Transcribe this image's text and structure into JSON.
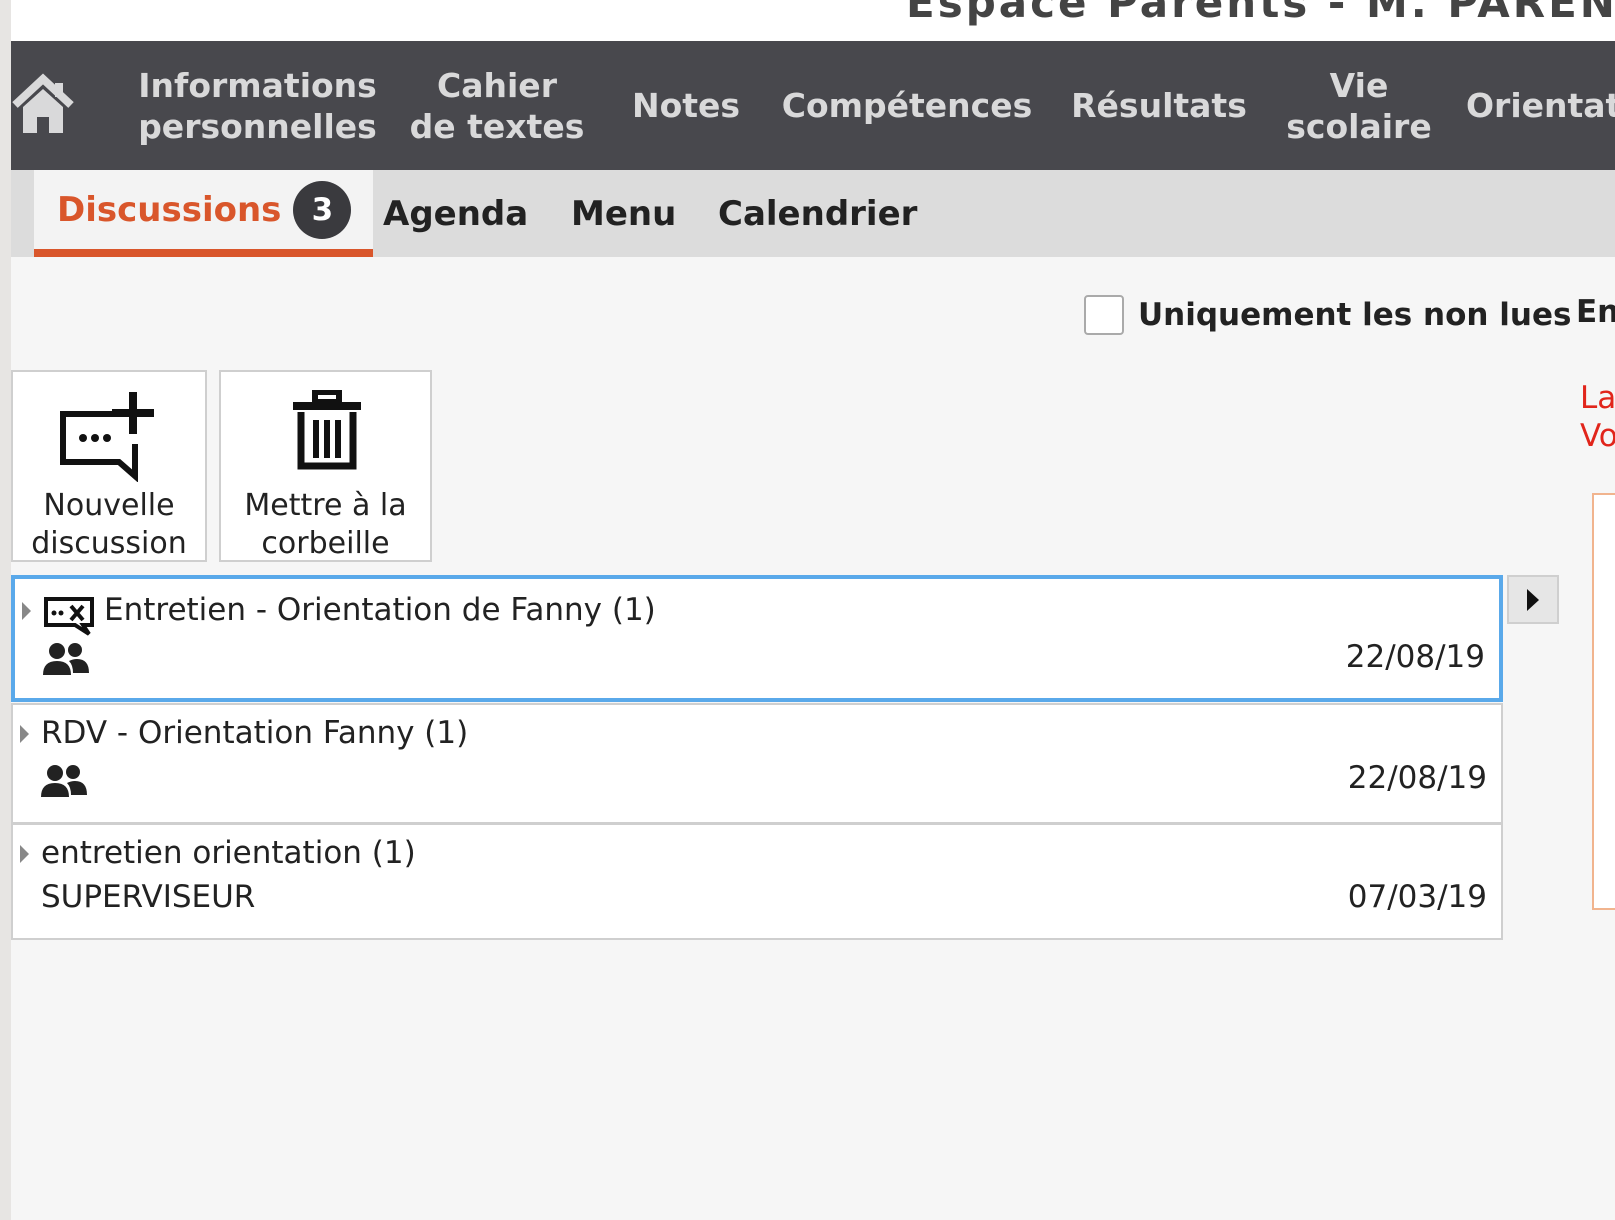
{
  "header": {
    "title": "Espace Parents - M. PARENT F"
  },
  "main_nav": {
    "home_icon": "home-icon",
    "items": [
      {
        "line1": "Informations",
        "line2": "personnelles"
      },
      {
        "line1": "Cahier",
        "line2": "de textes"
      },
      {
        "line1": "Notes"
      },
      {
        "line1": "Compétences"
      },
      {
        "line1": "Résultats"
      },
      {
        "line1": "Vie",
        "line2": "scolaire"
      },
      {
        "line1": "Orientat"
      }
    ]
  },
  "sub_nav": {
    "tabs": [
      {
        "label": "Discussions",
        "badge": "3",
        "active": true
      },
      {
        "label": "Agenda"
      },
      {
        "label": "Menu"
      },
      {
        "label": "Calendrier"
      }
    ]
  },
  "filters": {
    "unread_only_label": "Uniquement les non lues",
    "unread_only_checked": false,
    "cut_label": "En"
  },
  "notice": {
    "line1": "La",
    "line2": "Vo"
  },
  "actions": {
    "new_discussion": {
      "line1": "Nouvelle",
      "line2": "discussion",
      "icon": "new-message-icon"
    },
    "trash": {
      "line1": "Mettre à la",
      "line2": "corbeille",
      "icon": "trash-icon"
    }
  },
  "discussions": [
    {
      "title": "Entretien - Orientation de Fanny (1)",
      "participants_icon": "people-icon",
      "date": "22/08/19",
      "closed_icon": "closed-conversation-icon",
      "selected": true
    },
    {
      "title": "RDV - Orientation Fanny (1)",
      "participants_icon": "people-icon",
      "date": "22/08/19"
    },
    {
      "title": "entretien orientation (1)",
      "sender": "SUPERVISEUR",
      "date": "07/03/19"
    }
  ],
  "colors": {
    "accent": "#d9562b",
    "nav_bg": "#48484d",
    "selection": "#5aa9ea",
    "notice": "#e1251b"
  }
}
